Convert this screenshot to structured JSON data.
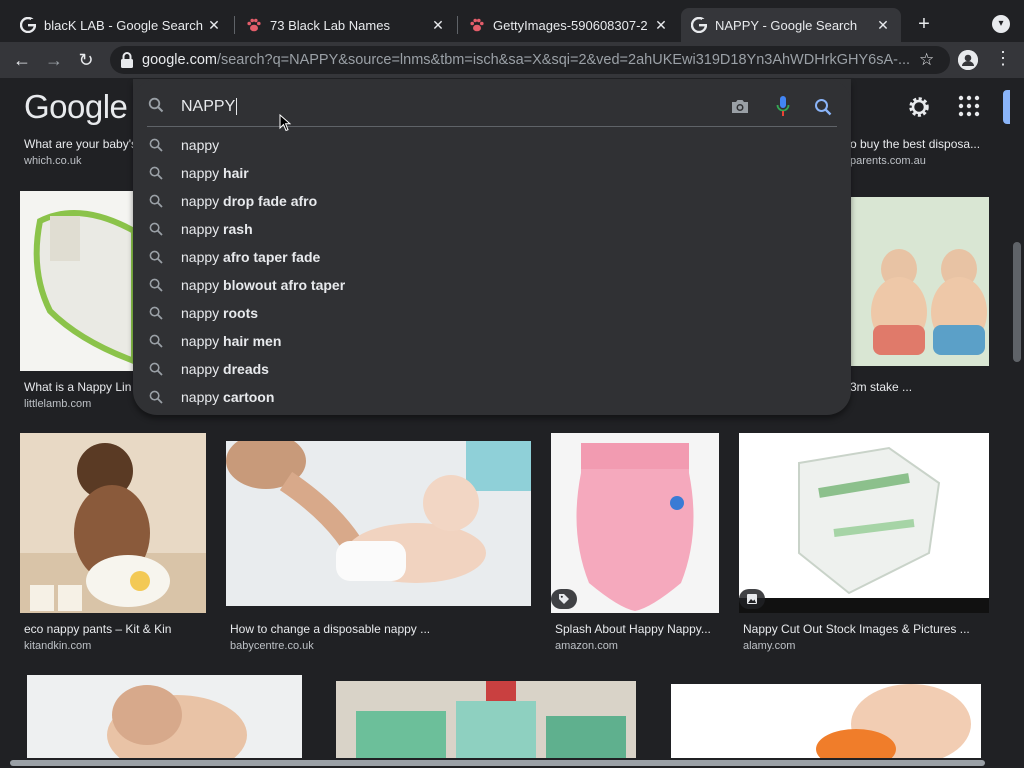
{
  "tabs": [
    {
      "title": "blacK LAB - Google Search",
      "favicon": "google-g-icon"
    },
    {
      "title": "73 Black Lab Names",
      "favicon": "paw-icon"
    },
    {
      "title": "GettyImages-590608307-2",
      "favicon": "paw-icon"
    },
    {
      "title": "NAPPY - Google Search",
      "favicon": "google-g-icon",
      "active": true
    }
  ],
  "address_bar": {
    "host": "google.com",
    "path": "/search?q=NAPPY&source=lnms&tbm=isch&sa=X&sqi=2&ved=2ahUKEwi319D18Yn3AhWDHrkGHY6sA-..."
  },
  "google": {
    "logo": "Google",
    "query": "NAPPY"
  },
  "suggestions": [
    {
      "prefix": "nappy",
      "bold": ""
    },
    {
      "prefix": "nappy",
      "bold": " hair"
    },
    {
      "prefix": "nappy",
      "bold": " drop fade afro"
    },
    {
      "prefix": "nappy",
      "bold": " rash"
    },
    {
      "prefix": "nappy",
      "bold": " afro taper fade"
    },
    {
      "prefix": "nappy",
      "bold": " blowout afro taper"
    },
    {
      "prefix": "nappy",
      "bold": " roots"
    },
    {
      "prefix": "nappy",
      "bold": " hair men"
    },
    {
      "prefix": "nappy",
      "bold": " dreads"
    },
    {
      "prefix": "nappy",
      "bold": " cartoon"
    }
  ],
  "results": {
    "row1_left": {
      "caption": "What are your baby's",
      "source": "which.co.uk"
    },
    "row1_right": {
      "caption": "o buy the best disposa...",
      "source": "parents.com.au"
    },
    "row2_left": {
      "caption": "What is a Nappy Lin",
      "source": "littlelamb.com"
    },
    "row2_right": {
      "caption": "3m stake ...",
      "source": ""
    },
    "row3": [
      {
        "caption": "eco nappy pants – Kit & Kin",
        "source": "kitandkin.com",
        "badge": ""
      },
      {
        "caption": "How to change a disposable nappy ...",
        "source": "babycentre.co.uk",
        "badge": ""
      },
      {
        "caption": "Splash About Happy Nappy...",
        "source": "amazon.com",
        "badge": "tag-icon"
      },
      {
        "caption": "Nappy Cut Out Stock Images & Pictures ...",
        "source": "alamy.com",
        "badge": "image-icon"
      }
    ]
  },
  "colors": {
    "background": "#202124",
    "surface": "#303134",
    "text": "#e8eaed",
    "muted": "#bdc1c6",
    "accent": "#8ab4f8"
  }
}
